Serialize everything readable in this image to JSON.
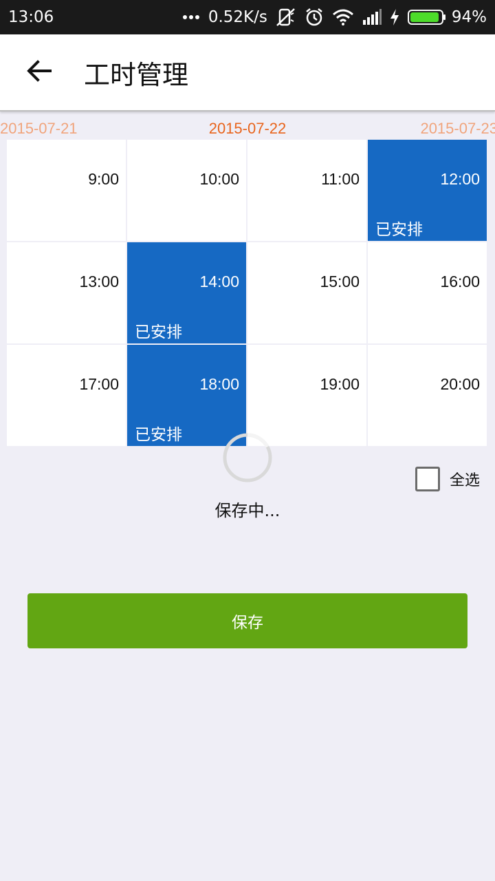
{
  "status_bar": {
    "time": "13:06",
    "network_speed": "0.52K/s",
    "battery_percent": "94%",
    "battery_level": 0.94,
    "icons": [
      "more-dots-icon",
      "mute-icon",
      "alarm-icon",
      "wifi-icon",
      "signal-icon",
      "charging-icon",
      "battery-icon"
    ]
  },
  "app_bar": {
    "title": "工时管理",
    "back_icon": "back-arrow-icon"
  },
  "date_strip": {
    "prev": "2015-07-21",
    "current": "2015-07-22",
    "next": "2015-07-23"
  },
  "slots": [
    {
      "time": "9:00",
      "tag": ""
    },
    {
      "time": "10:00",
      "tag": ""
    },
    {
      "time": "11:00",
      "tag": ""
    },
    {
      "time": "12:00",
      "tag": "已安排"
    },
    {
      "time": "13:00",
      "tag": ""
    },
    {
      "time": "14:00",
      "tag": "已安排"
    },
    {
      "time": "15:00",
      "tag": ""
    },
    {
      "time": "16:00",
      "tag": ""
    },
    {
      "time": "17:00",
      "tag": ""
    },
    {
      "time": "18:00",
      "tag": "已安排"
    },
    {
      "time": "19:00",
      "tag": ""
    },
    {
      "time": "20:00",
      "tag": ""
    }
  ],
  "colors": {
    "scheduled": "#1669c3",
    "date_current": "#e8641c",
    "date_adjacent": "#f0a47c",
    "save_button": "#62a613"
  },
  "loading": {
    "text": "保存中..."
  },
  "select_all": {
    "label": "全选",
    "checked": false
  },
  "save_button": {
    "label": "保存"
  }
}
